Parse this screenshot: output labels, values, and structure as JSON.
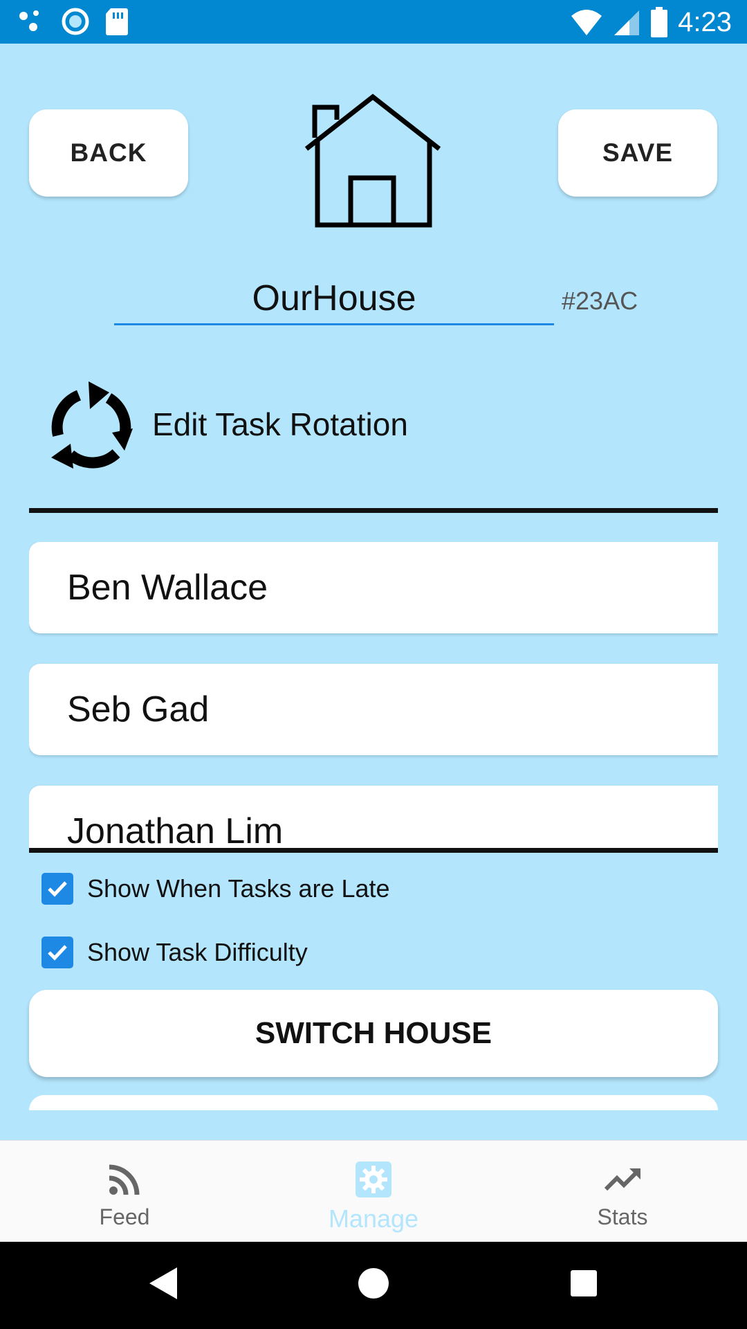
{
  "status_bar": {
    "time": "4:23"
  },
  "header": {
    "back_label": "BACK",
    "save_label": "SAVE"
  },
  "house": {
    "name": "OurHouse",
    "code": "#23AC"
  },
  "rotation": {
    "label": "Edit Task Rotation"
  },
  "members": [
    {
      "name": "Ben Wallace"
    },
    {
      "name": "Seb Gad"
    },
    {
      "name": "Jonathan Lim"
    }
  ],
  "options": {
    "show_late": {
      "label": "Show When Tasks are Late",
      "checked": true
    },
    "show_difficulty": {
      "label": "Show Task Difficulty",
      "checked": true
    }
  },
  "switch_house_label": "SWITCH HOUSE",
  "bottom_nav": {
    "items": [
      {
        "label": "Feed",
        "icon": "rss-feed-icon"
      },
      {
        "label": "Manage",
        "icon": "gear-icon"
      },
      {
        "label": "Stats",
        "icon": "trending-up-icon"
      }
    ],
    "active": "Manage"
  },
  "colors": {
    "background": "#B3E5FC",
    "status_bar": "#0288D1",
    "accent": "#1E88E5",
    "active_nav": "#B3E5FC"
  }
}
